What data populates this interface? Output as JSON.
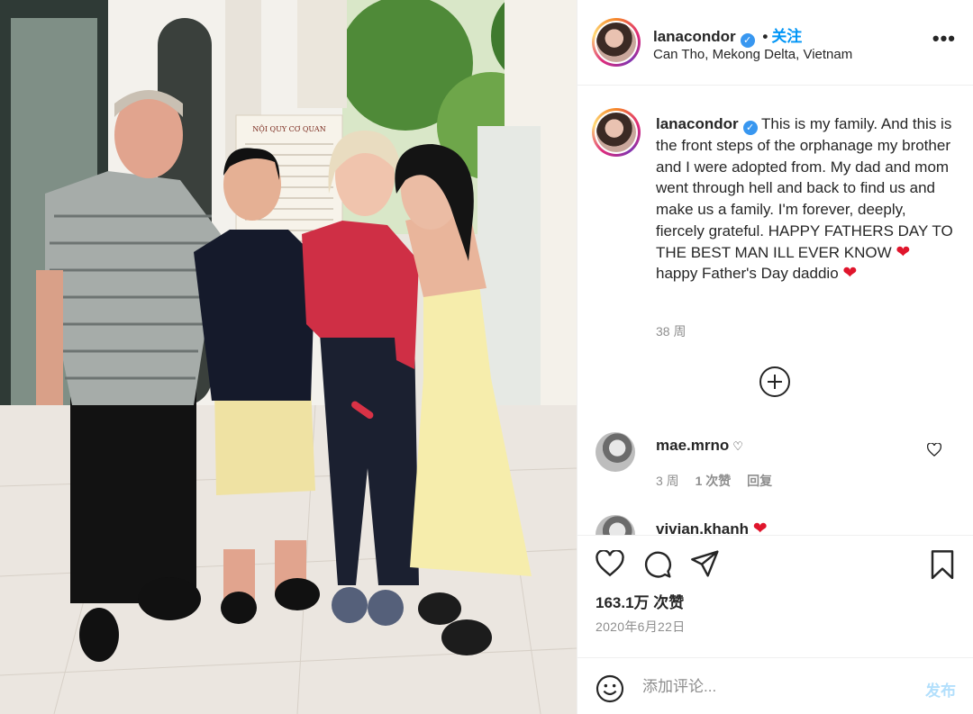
{
  "header": {
    "username": "lanacondor",
    "separator": "•",
    "follow_label": "关注",
    "location": "Can Tho, Mekong Delta, Vietnam",
    "more_label": "•••"
  },
  "photo": {
    "sign_title": "NỘI QUY CƠ QUAN"
  },
  "caption": {
    "username": "lanacondor",
    "text_1": "This is my family. And this is the front steps of the orphanage my brother and I were adopted from. My dad and mom went through hell and back to find us and make us a family. I'm forever, deeply, fiercely grateful. HAPPY FATHERS DAY TO THE BEST MAN ILL EVER KNOW",
    "emoji": "❤",
    "text_2": " happy Father's Day daddio ",
    "time": "38 周"
  },
  "comments": [
    {
      "username": "mae.mrno",
      "small_heart": "♡",
      "time": "3 周",
      "likes": "1 次赞",
      "reply": "回复"
    },
    {
      "username": "vivian.khanh",
      "emoji": "❤"
    }
  ],
  "stats": {
    "likes": "163.1万 次赞",
    "date": "2020年6月22日"
  },
  "add_comment": {
    "placeholder": "添加评论...",
    "post_label": "发布"
  },
  "icons": {
    "like": "heart-outline-icon",
    "comment": "speech-bubble-icon",
    "share": "paper-plane-icon",
    "save": "bookmark-icon",
    "emoji": "smiley-icon",
    "expand": "plus-circle-icon"
  },
  "colors": {
    "accent": "#0095f6",
    "verified": "#3897f0",
    "muted": "#8e8e8e",
    "post_disabled": "#b2dffc",
    "heart_red": "#e0152c"
  }
}
